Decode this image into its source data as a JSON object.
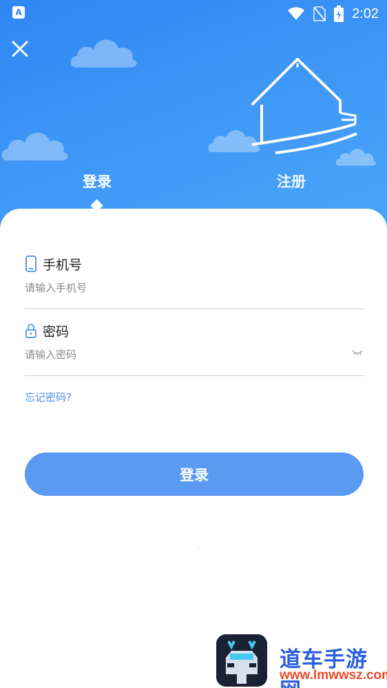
{
  "status_bar": {
    "app_icon_letter": "A",
    "time": "2:02",
    "icons": [
      "wifi-icon",
      "no-sim-icon",
      "battery-charging-icon"
    ]
  },
  "header": {
    "close_icon": "close-icon",
    "tabs": [
      {
        "label": "登录",
        "active": true
      },
      {
        "label": "注册",
        "active": false
      }
    ],
    "colors": {
      "gradient_start": "#2f86f4",
      "gradient_end": "#4aa7f8"
    }
  },
  "form": {
    "phone": {
      "icon": "phone-icon",
      "label": "手机号",
      "placeholder": "请输入手机号",
      "value": ""
    },
    "password": {
      "icon": "lock-icon",
      "label": "密码",
      "placeholder": "请输入密码",
      "value": "",
      "toggle_icon": "eye-closed-icon"
    },
    "forgot_password": "忘记密码?",
    "submit_label": "登录",
    "submit_color": "#5b9af3"
  },
  "watermark": {
    "title": "道车手游网",
    "url": "www.lmwwsz.com"
  }
}
